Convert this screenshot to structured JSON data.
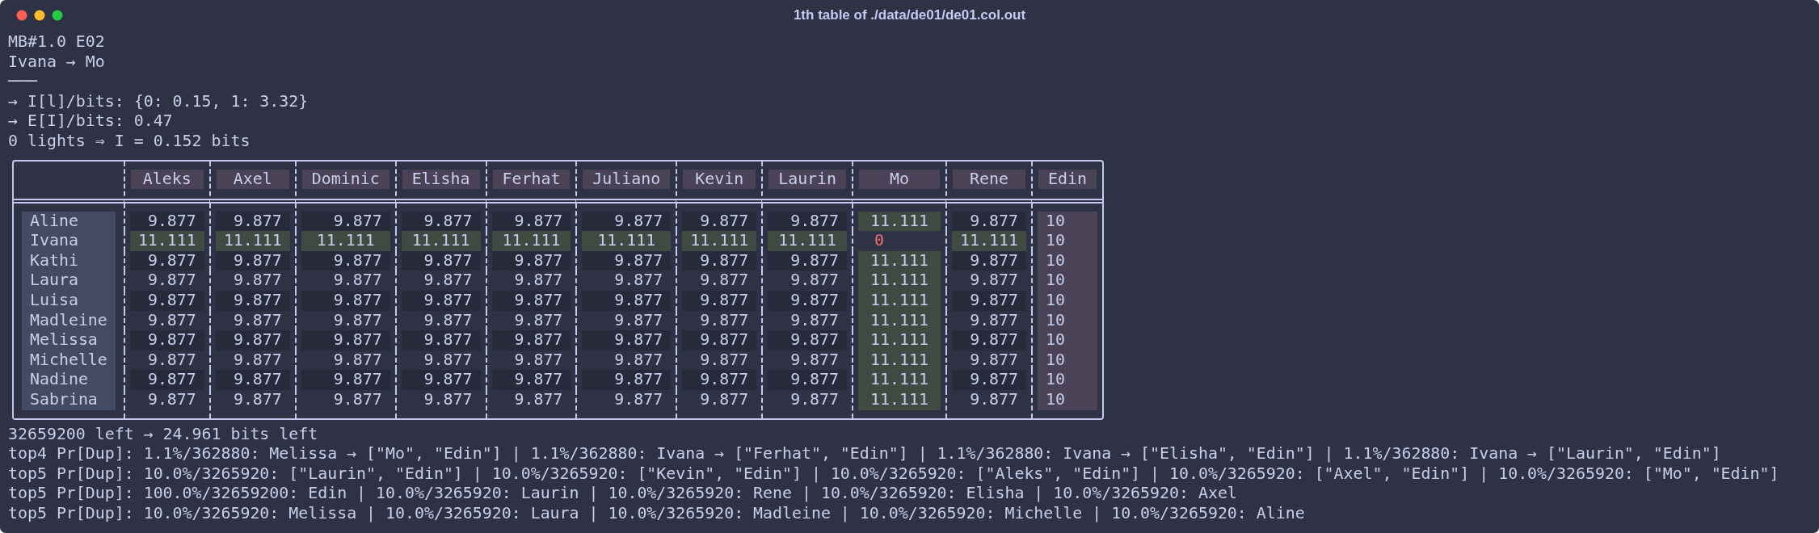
{
  "window": {
    "title": "1th table of ./data/de01/de01.col.out"
  },
  "header_lines": [
    "MB#1.0 E02",
    "Ivana → Mo",
    "───",
    "→ I[l]/bits: {0: 0.15, 1: 3.32}",
    "→ E[I]/bits: 0.47",
    "0 lights ⇒ I = 0.152 bits"
  ],
  "table": {
    "columns": [
      "Aleks",
      "Axel",
      "Dominic",
      "Elisha",
      "Ferhat",
      "Juliano",
      "Kevin",
      "Laurin",
      "Mo",
      "Rene",
      "Edin"
    ],
    "rows": [
      {
        "name": "Aline",
        "cells": [
          {
            "value": "9.877",
            "kind": "normal"
          },
          {
            "value": "9.877",
            "kind": "normal"
          },
          {
            "value": "9.877",
            "kind": "normal"
          },
          {
            "value": "9.877",
            "kind": "normal"
          },
          {
            "value": "9.877",
            "kind": "normal"
          },
          {
            "value": "9.877",
            "kind": "normal"
          },
          {
            "value": "9.877",
            "kind": "normal"
          },
          {
            "value": "9.877",
            "kind": "normal"
          },
          {
            "value": "11.111",
            "kind": "match"
          },
          {
            "value": "9.877",
            "kind": "normal"
          },
          {
            "value": "10",
            "kind": "total"
          }
        ]
      },
      {
        "name": "Ivana",
        "cells": [
          {
            "value": "11.111",
            "kind": "match"
          },
          {
            "value": "11.111",
            "kind": "match"
          },
          {
            "value": "11.111",
            "kind": "match"
          },
          {
            "value": "11.111",
            "kind": "match"
          },
          {
            "value": "11.111",
            "kind": "match"
          },
          {
            "value": "11.111",
            "kind": "match"
          },
          {
            "value": "11.111",
            "kind": "match"
          },
          {
            "value": "11.111",
            "kind": "match"
          },
          {
            "value": "0",
            "kind": "zero"
          },
          {
            "value": "11.111",
            "kind": "match"
          },
          {
            "value": "10",
            "kind": "total"
          }
        ]
      },
      {
        "name": "Kathi",
        "cells": [
          {
            "value": "9.877",
            "kind": "normal"
          },
          {
            "value": "9.877",
            "kind": "normal"
          },
          {
            "value": "9.877",
            "kind": "normal"
          },
          {
            "value": "9.877",
            "kind": "normal"
          },
          {
            "value": "9.877",
            "kind": "normal"
          },
          {
            "value": "9.877",
            "kind": "normal"
          },
          {
            "value": "9.877",
            "kind": "normal"
          },
          {
            "value": "9.877",
            "kind": "normal"
          },
          {
            "value": "11.111",
            "kind": "match"
          },
          {
            "value": "9.877",
            "kind": "normal"
          },
          {
            "value": "10",
            "kind": "total"
          }
        ]
      },
      {
        "name": "Laura",
        "cells": [
          {
            "value": "9.877",
            "kind": "normal"
          },
          {
            "value": "9.877",
            "kind": "normal"
          },
          {
            "value": "9.877",
            "kind": "normal"
          },
          {
            "value": "9.877",
            "kind": "normal"
          },
          {
            "value": "9.877",
            "kind": "normal"
          },
          {
            "value": "9.877",
            "kind": "normal"
          },
          {
            "value": "9.877",
            "kind": "normal"
          },
          {
            "value": "9.877",
            "kind": "normal"
          },
          {
            "value": "11.111",
            "kind": "match"
          },
          {
            "value": "9.877",
            "kind": "normal"
          },
          {
            "value": "10",
            "kind": "total"
          }
        ]
      },
      {
        "name": "Luisa",
        "cells": [
          {
            "value": "9.877",
            "kind": "normal"
          },
          {
            "value": "9.877",
            "kind": "normal"
          },
          {
            "value": "9.877",
            "kind": "normal"
          },
          {
            "value": "9.877",
            "kind": "normal"
          },
          {
            "value": "9.877",
            "kind": "normal"
          },
          {
            "value": "9.877",
            "kind": "normal"
          },
          {
            "value": "9.877",
            "kind": "normal"
          },
          {
            "value": "9.877",
            "kind": "normal"
          },
          {
            "value": "11.111",
            "kind": "match"
          },
          {
            "value": "9.877",
            "kind": "normal"
          },
          {
            "value": "10",
            "kind": "total"
          }
        ]
      },
      {
        "name": "Madleine",
        "cells": [
          {
            "value": "9.877",
            "kind": "normal"
          },
          {
            "value": "9.877",
            "kind": "normal"
          },
          {
            "value": "9.877",
            "kind": "normal"
          },
          {
            "value": "9.877",
            "kind": "normal"
          },
          {
            "value": "9.877",
            "kind": "normal"
          },
          {
            "value": "9.877",
            "kind": "normal"
          },
          {
            "value": "9.877",
            "kind": "normal"
          },
          {
            "value": "9.877",
            "kind": "normal"
          },
          {
            "value": "11.111",
            "kind": "match"
          },
          {
            "value": "9.877",
            "kind": "normal"
          },
          {
            "value": "10",
            "kind": "total"
          }
        ]
      },
      {
        "name": "Melissa",
        "cells": [
          {
            "value": "9.877",
            "kind": "normal"
          },
          {
            "value": "9.877",
            "kind": "normal"
          },
          {
            "value": "9.877",
            "kind": "normal"
          },
          {
            "value": "9.877",
            "kind": "normal"
          },
          {
            "value": "9.877",
            "kind": "normal"
          },
          {
            "value": "9.877",
            "kind": "normal"
          },
          {
            "value": "9.877",
            "kind": "normal"
          },
          {
            "value": "9.877",
            "kind": "normal"
          },
          {
            "value": "11.111",
            "kind": "match"
          },
          {
            "value": "9.877",
            "kind": "normal"
          },
          {
            "value": "10",
            "kind": "total"
          }
        ]
      },
      {
        "name": "Michelle",
        "cells": [
          {
            "value": "9.877",
            "kind": "normal"
          },
          {
            "value": "9.877",
            "kind": "normal"
          },
          {
            "value": "9.877",
            "kind": "normal"
          },
          {
            "value": "9.877",
            "kind": "normal"
          },
          {
            "value": "9.877",
            "kind": "normal"
          },
          {
            "value": "9.877",
            "kind": "normal"
          },
          {
            "value": "9.877",
            "kind": "normal"
          },
          {
            "value": "9.877",
            "kind": "normal"
          },
          {
            "value": "11.111",
            "kind": "match"
          },
          {
            "value": "9.877",
            "kind": "normal"
          },
          {
            "value": "10",
            "kind": "total"
          }
        ]
      },
      {
        "name": "Nadine",
        "cells": [
          {
            "value": "9.877",
            "kind": "normal"
          },
          {
            "value": "9.877",
            "kind": "normal"
          },
          {
            "value": "9.877",
            "kind": "normal"
          },
          {
            "value": "9.877",
            "kind": "normal"
          },
          {
            "value": "9.877",
            "kind": "normal"
          },
          {
            "value": "9.877",
            "kind": "normal"
          },
          {
            "value": "9.877",
            "kind": "normal"
          },
          {
            "value": "9.877",
            "kind": "normal"
          },
          {
            "value": "11.111",
            "kind": "match"
          },
          {
            "value": "9.877",
            "kind": "normal"
          },
          {
            "value": "10",
            "kind": "total"
          }
        ]
      },
      {
        "name": "Sabrina",
        "cells": [
          {
            "value": "9.877",
            "kind": "normal"
          },
          {
            "value": "9.877",
            "kind": "normal"
          },
          {
            "value": "9.877",
            "kind": "normal"
          },
          {
            "value": "9.877",
            "kind": "normal"
          },
          {
            "value": "9.877",
            "kind": "normal"
          },
          {
            "value": "9.877",
            "kind": "normal"
          },
          {
            "value": "9.877",
            "kind": "normal"
          },
          {
            "value": "9.877",
            "kind": "normal"
          },
          {
            "value": "11.111",
            "kind": "match"
          },
          {
            "value": "9.877",
            "kind": "normal"
          },
          {
            "value": "10",
            "kind": "total"
          }
        ]
      }
    ]
  },
  "footer_lines": [
    "32659200 left → 24.961 bits left",
    "top4 Pr[Dup]: 1.1%/362880: Melissa → [\"Mo\", \"Edin\"] | 1.1%/362880: Ivana → [\"Ferhat\", \"Edin\"] | 1.1%/362880: Ivana → [\"Elisha\", \"Edin\"] | 1.1%/362880: Ivana → [\"Laurin\", \"Edin\"]",
    "top5 Pr[Dup]: 10.0%/3265920: [\"Laurin\", \"Edin\"] | 10.0%/3265920: [\"Kevin\", \"Edin\"] | 10.0%/3265920: [\"Aleks\", \"Edin\"] | 10.0%/3265920: [\"Axel\", \"Edin\"] | 10.0%/3265920: [\"Mo\", \"Edin\"]",
    "top5 Pr[Dup]: 100.0%/32659200: Edin | 10.0%/3265920: Laurin | 10.0%/3265920: Rene | 10.0%/3265920: Elisha | 10.0%/3265920: Axel",
    "top5 Pr[Dup]: 10.0%/3265920: Melissa | 10.0%/3265920: Laura | 10.0%/3265920: Madleine | 10.0%/3265920: Michelle | 10.0%/3265920: Aline"
  ]
}
